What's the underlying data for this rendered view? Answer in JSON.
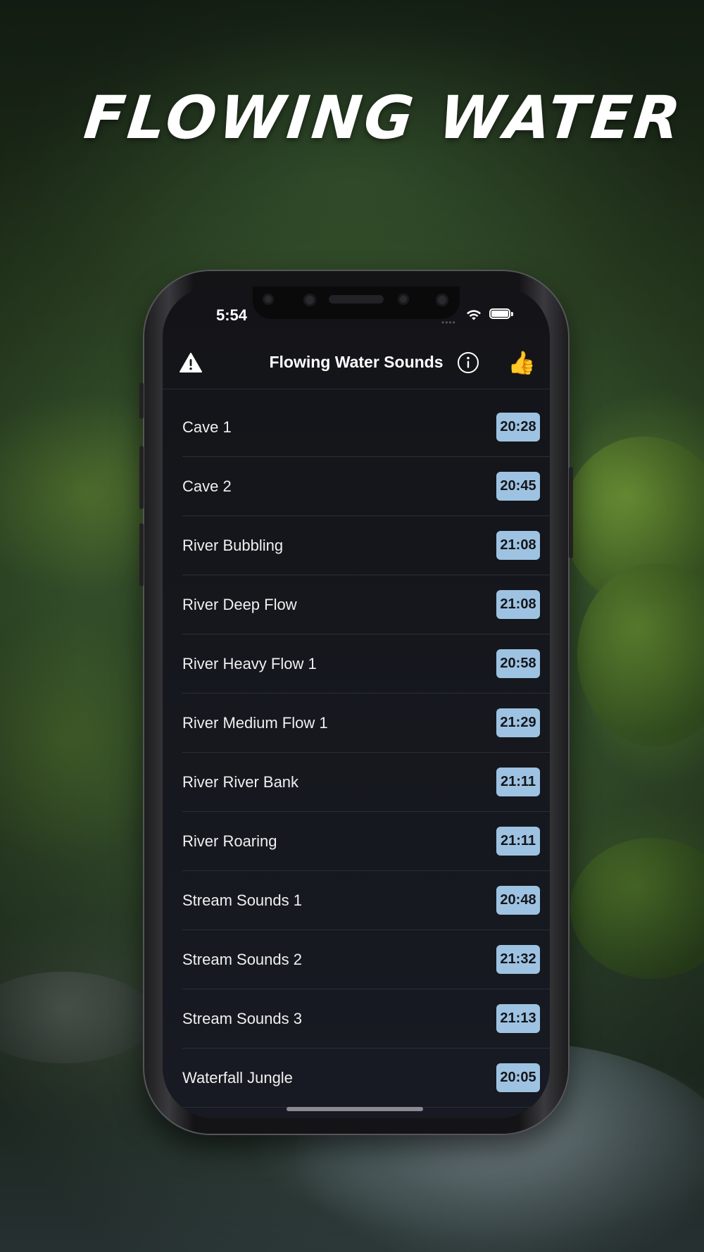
{
  "promo": {
    "headline": "FLOWING WATER"
  },
  "status_bar": {
    "time": "5:54",
    "signal_dots": "••••"
  },
  "navbar": {
    "title": "Flowing Water Sounds",
    "like_emoji": "👍"
  },
  "icons": {
    "warning": "warning-triangle-icon",
    "info": "info-circle-icon",
    "like": "thumbs-up-icon",
    "wifi": "wifi-icon",
    "battery": "battery-icon"
  },
  "colors": {
    "badge_bg": "#9ec3e2",
    "screen_bg": "#15171d"
  },
  "sounds": [
    {
      "name": "Cave 1",
      "duration": "20:28"
    },
    {
      "name": "Cave 2",
      "duration": "20:45"
    },
    {
      "name": "River Bubbling",
      "duration": "21:08"
    },
    {
      "name": "River Deep Flow",
      "duration": "21:08"
    },
    {
      "name": "River Heavy Flow 1",
      "duration": "20:58"
    },
    {
      "name": "River Medium Flow 1",
      "duration": "21:29"
    },
    {
      "name": "River River Bank",
      "duration": "21:11"
    },
    {
      "name": "River Roaring",
      "duration": "21:11"
    },
    {
      "name": "Stream Sounds 1",
      "duration": "20:48"
    },
    {
      "name": "Stream Sounds 2",
      "duration": "21:32"
    },
    {
      "name": "Stream Sounds 3",
      "duration": "21:13"
    },
    {
      "name": "Waterfall Jungle",
      "duration": "20:05"
    }
  ]
}
